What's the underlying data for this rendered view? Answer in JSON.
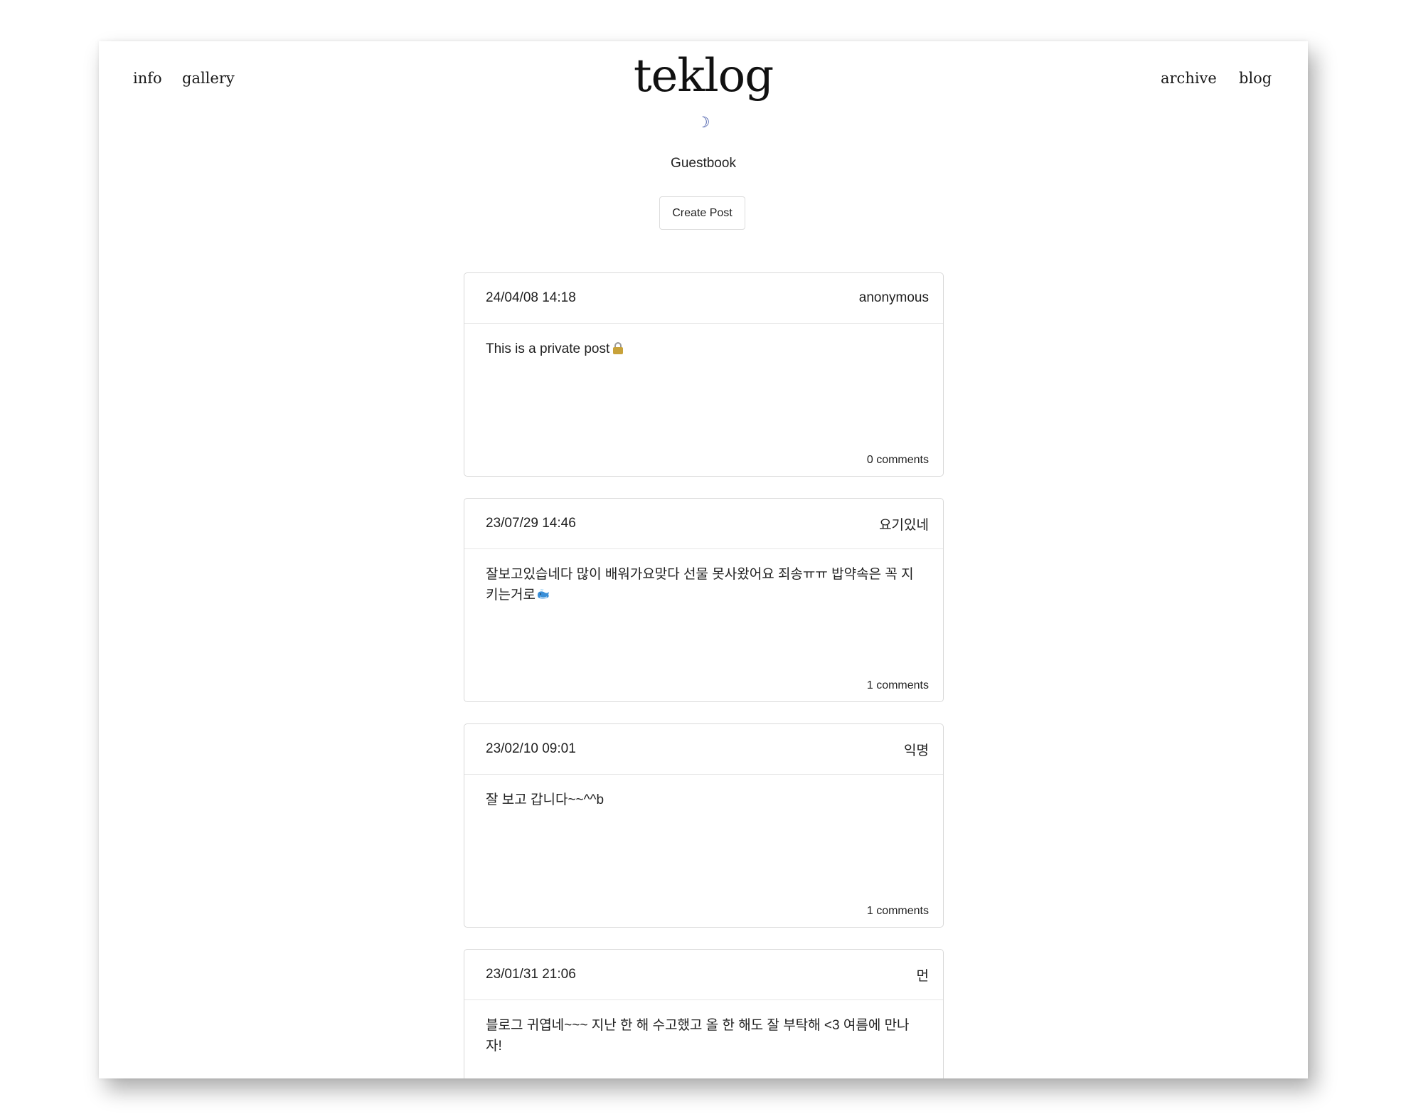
{
  "nav": {
    "left": [
      {
        "label": "info"
      },
      {
        "label": "gallery"
      }
    ],
    "right": [
      {
        "label": "archive"
      },
      {
        "label": "blog"
      }
    ]
  },
  "site": {
    "title": "teklog",
    "theme_toggle": "☽"
  },
  "page": {
    "heading": "Guestbook",
    "create_button": "Create Post"
  },
  "posts": [
    {
      "date": "24/04/08 14:18",
      "author": "anonymous",
      "content": "This is a private post",
      "icon": "lock-icon",
      "comments": "0 comments"
    },
    {
      "date": "23/07/29 14:46",
      "author": "요기있네",
      "content": "잘보고있습네다 많이 배워가요맞다 선물 못사왔어요 죄송ㅠㅠ 밥약속은 꼭 지키는거로",
      "icon": "whale-icon",
      "comments": "1 comments"
    },
    {
      "date": "23/02/10 09:01",
      "author": "익명",
      "content": "잘 보고 갑니다~~^^b",
      "comments": "1 comments"
    },
    {
      "date": "23/01/31 21:06",
      "author": "먼",
      "content": "블로그 귀엽네~~~ 지난 한 해 수고했고 올 한 해도 잘 부탁해 <3 여름에 만나자!",
      "comments": ""
    }
  ]
}
